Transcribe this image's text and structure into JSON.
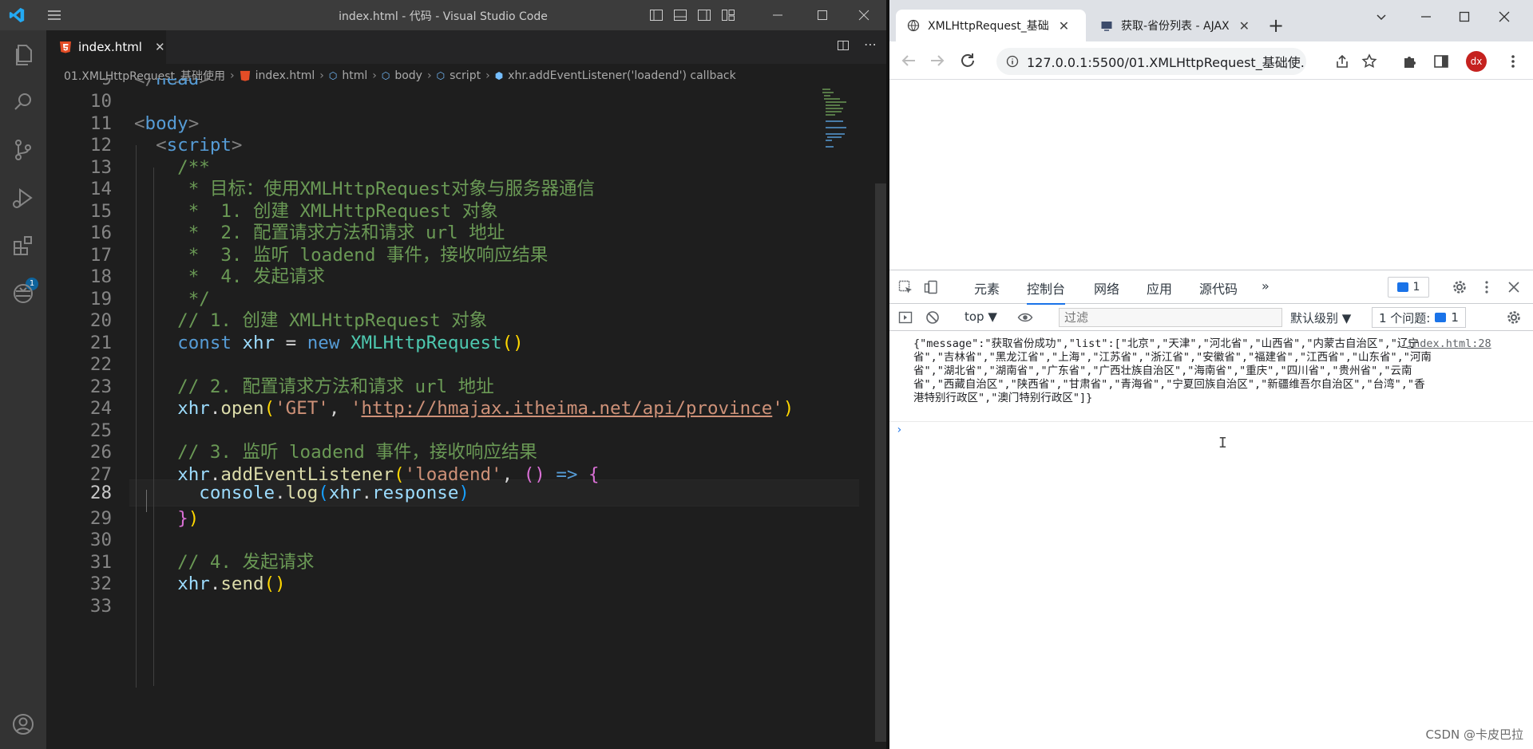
{
  "vscode": {
    "window_title": "index.html - 代码 - Visual Studio Code",
    "tab": {
      "label": "index.html",
      "close": "✕"
    },
    "breadcrumb": [
      "01.XMLHttpRequest_基础使用",
      "index.html",
      "html",
      "body",
      "script",
      "xhr.addEventListener('loadend') callback"
    ],
    "activity_badge": "1",
    "line_numbers": [
      "9",
      "10",
      "11",
      "12",
      "13",
      "14",
      "15",
      "16",
      "17",
      "18",
      "19",
      "20",
      "21",
      "22",
      "23",
      "24",
      "25",
      "26",
      "27",
      "28",
      "29",
      "30",
      "31",
      "32",
      "33"
    ],
    "active_line": "28"
  },
  "chrome": {
    "tabs": [
      {
        "label": "XMLHttpRequest_基础",
        "close": "✕"
      },
      {
        "label": "获取-省份列表 - AJAX",
        "close": "✕"
      }
    ],
    "new_tab": "+",
    "url": "127.0.0.1:5500/01.XMLHttpRequest_基础使...",
    "avatar": "dx"
  },
  "devtools": {
    "tabs": [
      "元素",
      "控制台",
      "网络",
      "应用",
      "源代码",
      "»"
    ],
    "issues_count": "1",
    "context": "top ▼",
    "filter_placeholder": "过滤",
    "levels": "默认级别 ▼",
    "issues_label": "1 个问题:",
    "issues_label_count": "1",
    "console_message": "{\"message\":\"获取省份成功\",\"list\":[\"北京\",\"天津\",\"河北省\",\"山西省\",\"内蒙古自治区\",\"辽宁省\",\"吉林省\",\"黑龙江省\",\"上海\",\"江苏省\",\"浙江省\",\"安徽省\",\"福建省\",\"江西省\",\"山东省\",\"河南省\",\"湖北省\",\"湖南省\",\"广东省\",\"广西壮族自治区\",\"海南省\",\"重庆\",\"四川省\",\"贵州省\",\"云南省\",\"西藏自治区\",\"陕西省\",\"甘肃省\",\"青海省\",\"宁夏回族自治区\",\"新疆维吾尔自治区\",\"台湾\",\"香港特别行政区\",\"澳门特别行政区\"]}",
    "console_source": "index.html:28",
    "prompt": "›"
  },
  "watermark": "CSDN @卡皮巴拉",
  "colors": {
    "vscode_bg": "#1e1e1e",
    "activity": "#333333",
    "accent": "#1a73e8"
  }
}
